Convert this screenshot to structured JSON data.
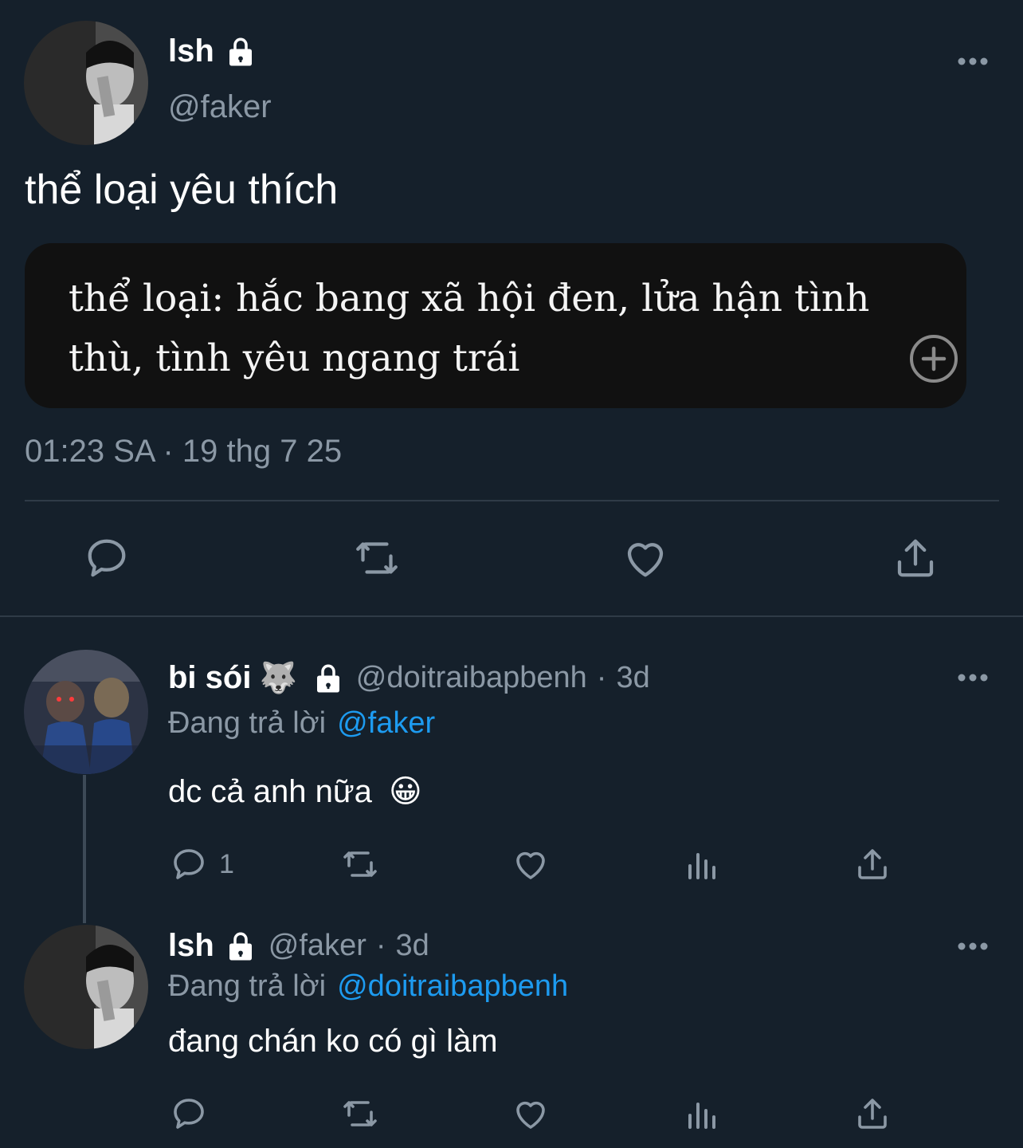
{
  "main_tweet": {
    "name": "lsh",
    "handle": "@faker",
    "text": "thể loại yêu thích",
    "quote_text": "thể loại: hắc bang xã hội đen, lửa hận tình thù, tình yêu ngang trái",
    "time": "01:23 SA · 19 thg 7 25"
  },
  "replies": [
    {
      "name": "bi sói",
      "name_emoji": "🐺",
      "handle": "@doitraibapbenh",
      "separator": "·",
      "time": "3d",
      "replying_label": "Đang trả lời",
      "replying_to": "@faker",
      "text": "dc cả anh nữa",
      "text_emoji": "😀",
      "reply_count": "1"
    },
    {
      "name": "lsh",
      "handle": "@faker",
      "separator": "·",
      "time": "3d",
      "replying_label": "Đang trả lời",
      "replying_to": "@doitraibapbenh",
      "text": "đang chán ko có gì làm"
    }
  ],
  "colors": {
    "background": "#15202b",
    "secondary_text": "#8b98a5",
    "link": "#1d9bf0",
    "quote_bg": "#111111"
  },
  "icons": [
    "lock-icon",
    "more-icon",
    "reply-icon",
    "retweet-icon",
    "like-icon",
    "share-icon",
    "views-icon",
    "add-circle-icon"
  ]
}
